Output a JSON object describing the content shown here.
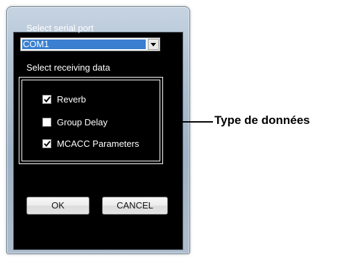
{
  "dialog": {
    "port_label": "Select serial port",
    "port_value": "COM1",
    "data_label": "Select receiving data",
    "checkboxes": [
      {
        "label": "Reverb",
        "checked": true
      },
      {
        "label": "Group Delay",
        "checked": false
      },
      {
        "label": "MCACC Parameters",
        "checked": true
      }
    ],
    "ok_label": "OK",
    "cancel_label": "CANCEL"
  },
  "annotation": {
    "text": "Type de données"
  },
  "icons": {
    "dropdown": "chevron-down-icon",
    "check": "checkmark-icon"
  },
  "colors": {
    "client_bg": "#000000",
    "selection": "#3a7fd0",
    "frame": "#b3c3d3"
  }
}
